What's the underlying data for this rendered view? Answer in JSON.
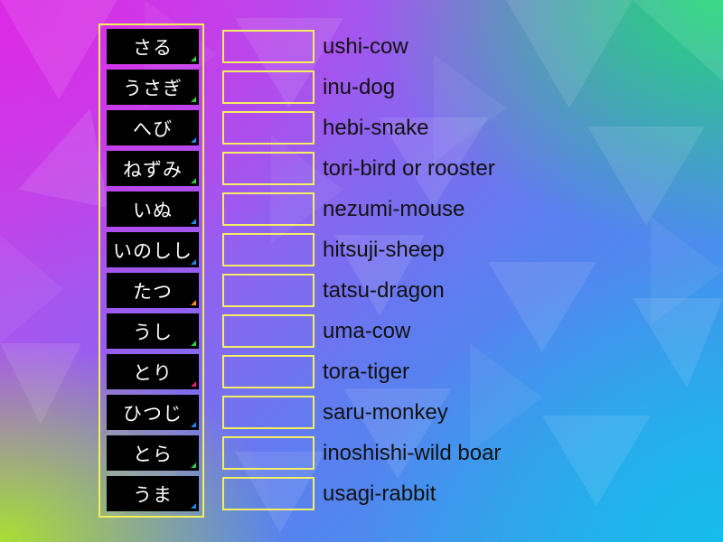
{
  "game": {
    "tiles": [
      {
        "text": "さる",
        "accent": "#2ecc40"
      },
      {
        "text": "うさぎ",
        "accent": "#2ecc40"
      },
      {
        "text": "へび",
        "accent": "#1e88e5"
      },
      {
        "text": "ねずみ",
        "accent": "#2ecc40"
      },
      {
        "text": "いぬ",
        "accent": "#1e88e5"
      },
      {
        "text": "いのしし",
        "accent": "#1e88e5"
      },
      {
        "text": "たつ",
        "accent": "#ff8a1e"
      },
      {
        "text": "うし",
        "accent": "#2ecc40"
      },
      {
        "text": "とり",
        "accent": "#e91e63"
      },
      {
        "text": "ひつじ",
        "accent": "#1e88e5"
      },
      {
        "text": "とら",
        "accent": "#2ecc40"
      },
      {
        "text": "うま",
        "accent": "#1e88e5"
      }
    ],
    "targets": [
      {
        "label": "ushi-cow"
      },
      {
        "label": "inu-dog"
      },
      {
        "label": "hebi-snake"
      },
      {
        "label": "tori-bird or rooster"
      },
      {
        "label": "nezumi-mouse"
      },
      {
        "label": "hitsuji-sheep"
      },
      {
        "label": "tatsu-dragon"
      },
      {
        "label": "uma-cow"
      },
      {
        "label": "tora-tiger"
      },
      {
        "label": "saru-monkey"
      },
      {
        "label": "inoshishi-wild boar"
      },
      {
        "label": "usagi-rabbit"
      }
    ],
    "colors": {
      "tile_border": "#f4f05a",
      "slot_border": "#f4ef63",
      "tile_background": "#000000"
    }
  }
}
